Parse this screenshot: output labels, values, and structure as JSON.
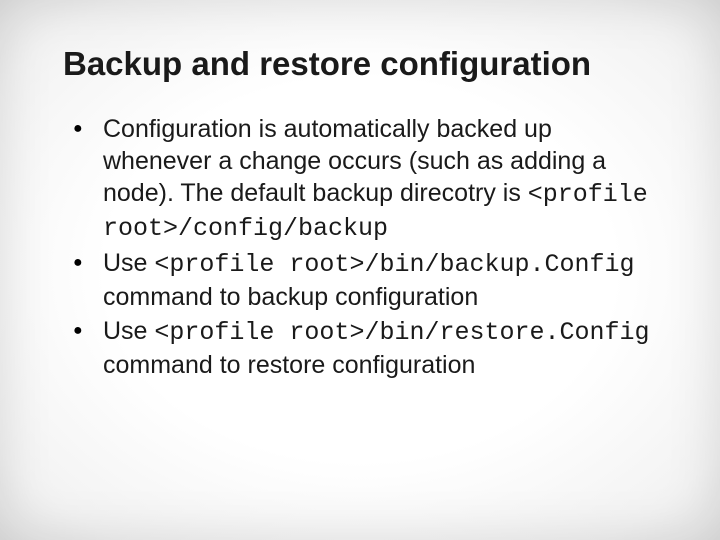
{
  "title": "Backup and restore configuration",
  "bullets": [
    {
      "r1": "Configuration is automatically backed up whenever a change occurs (such as adding a node). The default backup direcotry is ",
      "c1": "<profile root>/config/backup"
    },
    {
      "r1": "Use ",
      "c1": "<profile root>/bin/backup.Config",
      "r2": " command to backup configuration"
    },
    {
      "r1": "Use ",
      "c1": "<profile root>/bin/restore.Config",
      "r2": " command to restore configuration"
    }
  ]
}
